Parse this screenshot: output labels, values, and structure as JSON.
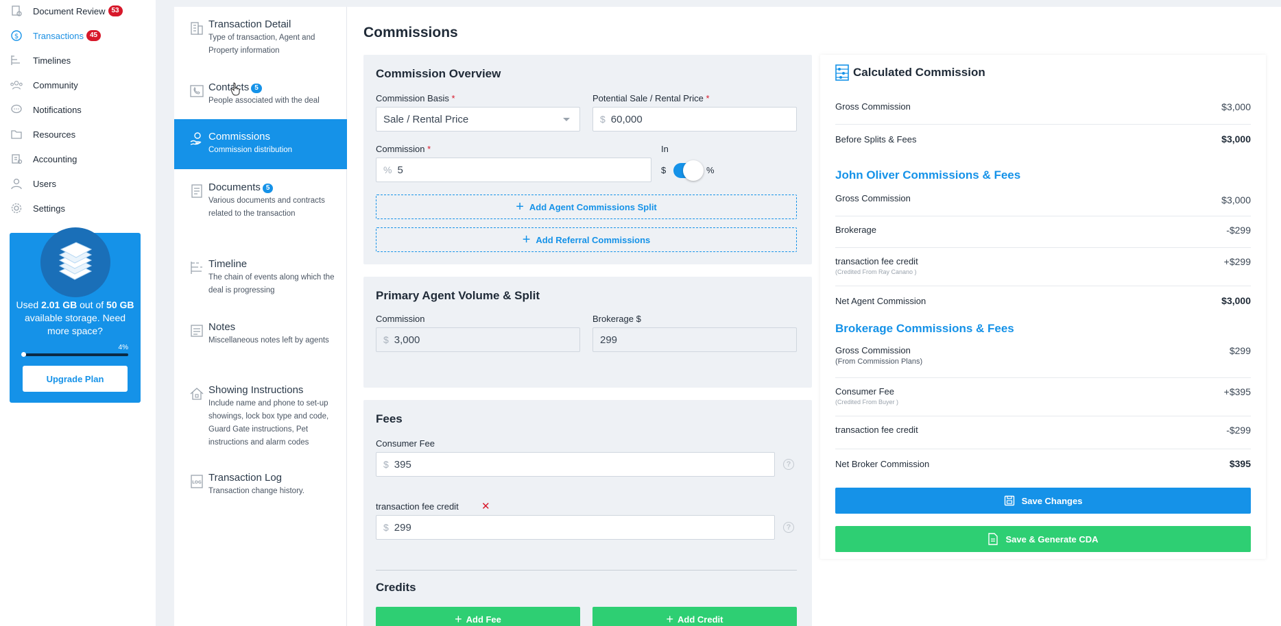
{
  "sidebar": {
    "items": [
      {
        "label": "Document Review",
        "badge": "53",
        "icon": "document-review-icon"
      },
      {
        "label": "Transactions",
        "badge": "45",
        "icon": "transactions-icon",
        "active": true
      },
      {
        "label": "Timelines",
        "badge": "",
        "icon": "timelines-icon"
      },
      {
        "label": "Community",
        "badge": "",
        "icon": "community-icon"
      },
      {
        "label": "Notifications",
        "badge": "",
        "icon": "notifications-icon"
      },
      {
        "label": "Resources",
        "badge": "",
        "icon": "resources-icon"
      },
      {
        "label": "Accounting",
        "badge": "",
        "icon": "accounting-icon"
      },
      {
        "label": "Users",
        "badge": "",
        "icon": "users-icon"
      },
      {
        "label": "Settings",
        "badge": "",
        "icon": "settings-icon"
      }
    ],
    "storage": {
      "text_pre": "Used ",
      "used": "2.01 GB",
      "text_mid": " out of ",
      "total": "50 GB",
      "text_post": " available storage. Need more space?",
      "percent_label": "4%",
      "percent": 4,
      "upgrade_label": "Upgrade Plan"
    }
  },
  "sections": [
    {
      "title": "Transaction Detail",
      "desc": "Type of transaction, Agent and Property information",
      "badge": ""
    },
    {
      "title": "Contacts",
      "desc": "People associated with the deal",
      "badge": "5"
    },
    {
      "title": "Commissions",
      "desc": "Commission distribution",
      "badge": "",
      "active": true
    },
    {
      "title": "Documents",
      "desc": "Various documents and contracts related to the transaction",
      "badge": "5"
    },
    {
      "title": "Timeline",
      "desc": "The chain of events along which the deal is progressing",
      "badge": ""
    },
    {
      "title": "Notes",
      "desc": "Miscellaneous notes left by agents",
      "badge": ""
    },
    {
      "title": "Showing Instructions",
      "desc": "Include name and phone to set-up showings, lock box type and code, Guard Gate instructions, Pet instructions and alarm codes",
      "badge": ""
    },
    {
      "title": "Transaction Log",
      "desc": "Transaction change history.",
      "badge": ""
    }
  ],
  "main": {
    "title": "Commissions",
    "overview": {
      "heading": "Commission Overview",
      "basis_label": "Commission Basis",
      "basis_value": "Sale / Rental Price",
      "price_label": "Potential Sale / Rental Price",
      "price_prefix": "$",
      "price_value": "60,000",
      "commission_label": "Commission",
      "commission_prefix": "%",
      "commission_value": "5",
      "in_label": "In",
      "toggle_left": "$",
      "toggle_right": "%",
      "req": "*",
      "add_split": "Add Agent Commissions Split",
      "add_referral": "Add Referral Commissions"
    },
    "primary": {
      "heading": "Primary Agent Volume & Split",
      "commission_label": "Commission",
      "commission_prefix": "$",
      "commission_value": "3,000",
      "brokerage_label": "Brokerage $",
      "brokerage_value": "299"
    },
    "fees": {
      "heading": "Fees",
      "consumer_label": "Consumer Fee",
      "consumer_prefix": "$",
      "consumer_value": "395",
      "credit_label": "transaction fee credit",
      "credit_prefix": "$",
      "credit_value": "299",
      "help": "?"
    },
    "credits": {
      "heading": "Credits",
      "add_fee": "Add Fee",
      "add_credit": "Add Credit"
    }
  },
  "calc": {
    "title": "Calculated Commission",
    "gross_label": "Gross Commission",
    "gross_value": "$3,000",
    "before_label": "Before Splits & Fees",
    "before_value": "$3,000",
    "agent_heading": "John Oliver Commissions & Fees",
    "agent_gross_label": "Gross Commission",
    "agent_gross_value": "$3,000",
    "agent_brokerage_label": "Brokerage",
    "agent_brokerage_value": "-$299",
    "agent_credit_label": "transaction fee credit",
    "agent_credit_sub": "(Credited From Ray Canano )",
    "agent_credit_value": "+$299",
    "agent_net_label": "Net Agent Commission",
    "agent_net_value": "$3,000",
    "broker_heading": "Brokerage Commissions & Fees",
    "broker_gross_label": "Gross Commission",
    "broker_gross_sub": "(From Commission Plans)",
    "broker_gross_value": "$299",
    "broker_consumer_label": "Consumer Fee",
    "broker_consumer_sub": "(Credited From Buyer )",
    "broker_consumer_value": "+$395",
    "broker_credit_label": "transaction fee credit",
    "broker_credit_value": "-$299",
    "broker_net_label": "Net Broker Commission",
    "broker_net_value": "$395",
    "save_label": "Save Changes",
    "cda_label": "Save & Generate CDA"
  },
  "colors": {
    "accent": "#1592e8",
    "green": "#2ecf73",
    "badge_red": "#d7182a"
  }
}
